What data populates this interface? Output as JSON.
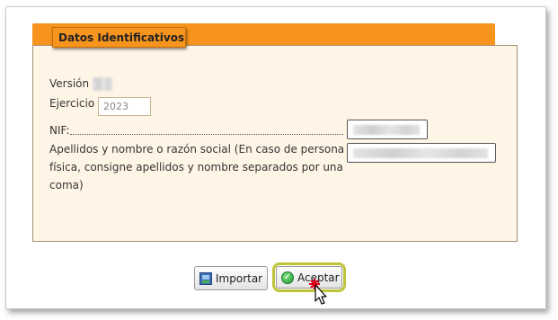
{
  "panel": {
    "title": "Datos Identificativos"
  },
  "form": {
    "version_label": "Versión",
    "ejercicio_label": "Ejercicio",
    "ejercicio_value": "2023",
    "nif_label": "NIF:",
    "apellidos_label_line1": "Apellidos y nombre o razón social (En caso de persona",
    "apellidos_label_line2": "física, consigne apellidos y nombre separados por una",
    "apellidos_label_line3": "coma)"
  },
  "buttons": {
    "importar": "Importar",
    "aceptar": "Aceptar"
  },
  "icons": {
    "importar": "import-icon",
    "aceptar": "check-icon",
    "cursor": "mouse-pointer-icon",
    "click": "click-burst-icon"
  },
  "colors": {
    "header_orange": "#f7941d",
    "panel_background": "#fff5e6",
    "focus_ring": "#bfc43a"
  }
}
